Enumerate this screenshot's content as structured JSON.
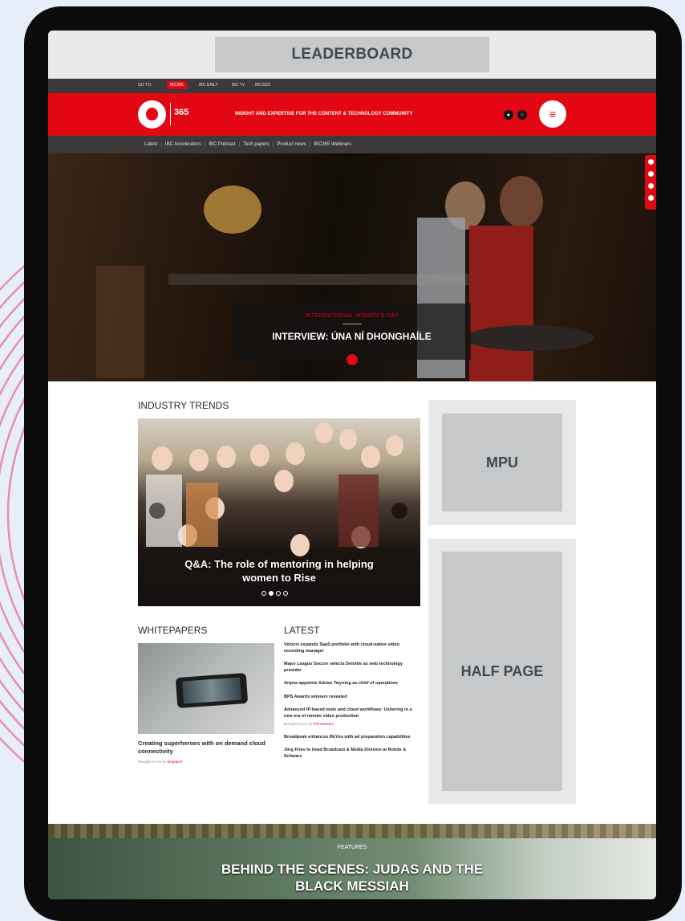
{
  "leaderboard": {
    "label": "LEADERBOARD"
  },
  "top_nav": {
    "items": [
      "GO TO:",
      "IBC365",
      "IBC DAILY",
      "IBC TV",
      "IBC2021"
    ]
  },
  "header": {
    "brand_label": "365",
    "tagline": "INSIGHT AND EXPERTISE FOR THE CONTENT & TECHNOLOGY COMMUNITY",
    "icons": [
      "user-icon",
      "search-icon",
      "menu-icon"
    ],
    "accent_color": "#e30613"
  },
  "sub_nav": {
    "items": [
      "Latest",
      "IBC Accelerators",
      "IBC Podcast",
      "Tech papers",
      "Product news",
      "IBC365 Webinars"
    ]
  },
  "hero": {
    "kicker": "INTERNATIONAL WOMEN'S DAY",
    "title": "INTERVIEW: ÚNA NÍ DHONGHAÍLE"
  },
  "industry_trends": {
    "heading": "INDUSTRY TRENDS",
    "caption": "Q&A: The role of mentoring in helping women to Rise",
    "slide_count": 4,
    "active_slide": 2
  },
  "ads": {
    "mpu": "MPU",
    "half_page": "HALF PAGE"
  },
  "whitepapers": {
    "heading": "WHITEPAPERS",
    "title": "Creating superheroes with on demand cloud connectivity",
    "meta_prefix": "Brought to you by",
    "sponsor": "Megaport"
  },
  "latest": {
    "heading": "LATEST",
    "items": [
      {
        "title": "Velocix expands SaaS portfolio with cloud-native video recording manager"
      },
      {
        "title": "Major League Soccer selects Deloitte as web technology provider"
      },
      {
        "title": "Arqiva appoints Adrian Twyning as chief of operations"
      },
      {
        "title": "BPS Awards winners revealed"
      },
      {
        "title": "Advanced IP-based tools and cloud workflows: Ushering in a new era of remote video production",
        "meta_prefix": "Brought to you by",
        "sponsor": "Primestream"
      },
      {
        "title": "Broadpeak enhances BkYou with ad preparation capabilities"
      },
      {
        "title": "Jörg Fries to head Broadcast & Media Division at Rohde & Schwarz"
      }
    ]
  },
  "features": {
    "kicker": "FEATURES",
    "title": "BEHIND THE SCENES: JUDAS AND THE BLACK MESSIAH"
  }
}
